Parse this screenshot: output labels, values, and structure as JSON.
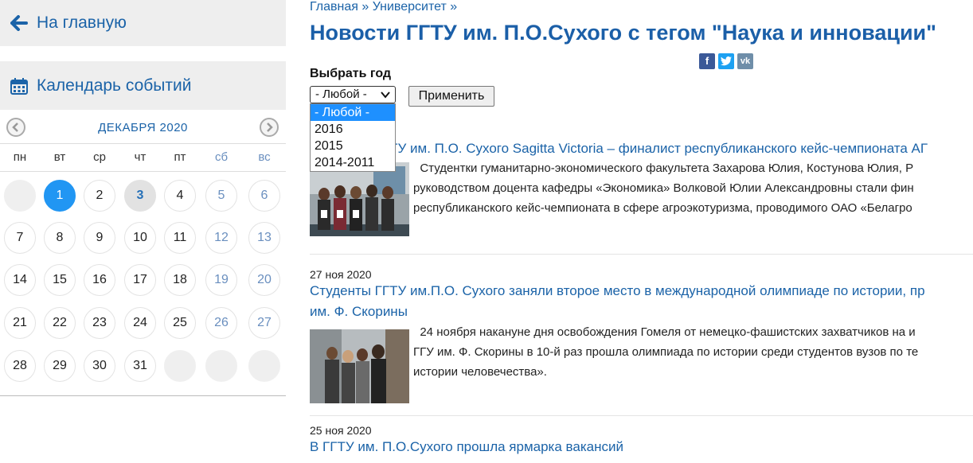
{
  "sidebar": {
    "home_label": "На главную",
    "calendar_label": "Календарь событий",
    "calendar": {
      "month": "ДЕКАБРЯ 2020",
      "weekdays": [
        "пн",
        "вт",
        "ср",
        "чт",
        "пт",
        "сб",
        "вс"
      ],
      "weeks": [
        [
          "",
          "1",
          "2",
          "3",
          "4",
          "5",
          "6"
        ],
        [
          "7",
          "8",
          "9",
          "10",
          "11",
          "12",
          "13"
        ],
        [
          "14",
          "15",
          "16",
          "17",
          "18",
          "19",
          "20"
        ],
        [
          "21",
          "22",
          "23",
          "24",
          "25",
          "26",
          "27"
        ],
        [
          "28",
          "29",
          "30",
          "31",
          "",
          "",
          ""
        ]
      ],
      "selected_day": "1",
      "today": "3"
    }
  },
  "main": {
    "breadcrumb": "Главная » Университет »",
    "title": "Новости ГГТУ им. П.О.Сухого с тегом \"Наука и инновации\"",
    "share_icons": [
      "facebook-icon",
      "twitter-icon",
      "vk-icon"
    ],
    "filter": {
      "label": "Выбрать год",
      "selected": "- Любой -",
      "options": [
        "- Любой -",
        "2016",
        "2015",
        "2014-2011"
      ],
      "apply_label": "Применить"
    },
    "news": [
      {
        "date": "",
        "title": "ГГТУ им. П.О. Сухого Sagitta Victoria – финалист республиканского кейс-чемпионата АГ",
        "text_lines": [
          "Студентки гуманитарно-экономического факультета Захарова Юлия, Костунова Юлия, Р",
          "руководством доцента кафедры «Экономика» Волковой Юлии Александровны стали фин",
          "республиканского кейс-чемпионата в сфере агроэкотуризма, проводимого ОАО «Белагро"
        ]
      },
      {
        "date": "27 ноя 2020",
        "title": "Студенты ГГТУ им.П.О. Сухого заняли второе место в международной олимпиаде по истории, пр",
        "title2": "им. Ф. Скорины",
        "text_lines": [
          "24 ноября накануне дня освобождения Гомеля от немецко-фашистских захватчиков на и",
          "ГГУ им. Ф. Скорины в 10-й раз прошла олимпиада по истории среди студентов вузов по те",
          "истории человечества»."
        ]
      },
      {
        "date": "25 ноя 2020",
        "title": "В ГГТУ им. П.О.Сухого прошла ярмарка вакансий"
      }
    ]
  },
  "colors": {
    "accent": "#1b63a8",
    "selected_day": "#2196f3",
    "dropdown_highlight": "#1e90ff"
  }
}
